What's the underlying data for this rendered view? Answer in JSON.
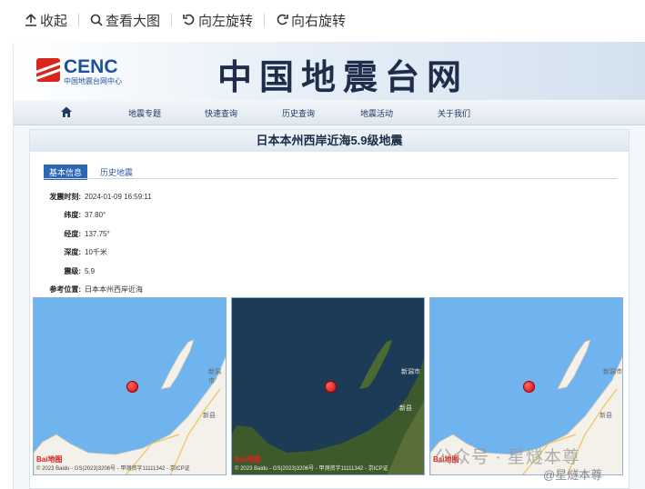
{
  "toolbar": {
    "collapse": "收起",
    "view_large": "查看大图",
    "rotate_left": "向左旋转",
    "rotate_right": "向右旋转"
  },
  "site": {
    "logo": "CENC",
    "logo_sub": "中国地震台网中心",
    "title": "中国地震台网"
  },
  "nav": [
    "地震专题",
    "快速查询",
    "历史查询",
    "地震活动",
    "关于我们"
  ],
  "page_title": "日本本州西岸近海5.9级地震",
  "tabs": [
    "基本信息",
    "历史地震"
  ],
  "info": [
    {
      "k": "发震时刻:",
      "v": "2024-01-09 16:59:11"
    },
    {
      "k": "纬度:",
      "v": "37.80°"
    },
    {
      "k": "经度:",
      "v": "137.75°"
    },
    {
      "k": "深度:",
      "v": "10千米"
    },
    {
      "k": "震级:",
      "v": "5.9"
    },
    {
      "k": "参考位置:",
      "v": "日本本州西岸近海"
    }
  ],
  "maps": {
    "city1": "新潟市",
    "city2": "新县",
    "copyright": "© 2023 Baidu - GS(2023)3206号 - 甲测资字11111342 - 京ICP证",
    "baidu": "Bai",
    "baidu_red": "地图"
  },
  "watermark": {
    "main": "公众号 · 星燧本尊",
    "handle": "@星燧本尊"
  },
  "colors": {
    "accent": "#2d67b3",
    "marker": "#d60000",
    "sea": "#6fb4ee"
  }
}
